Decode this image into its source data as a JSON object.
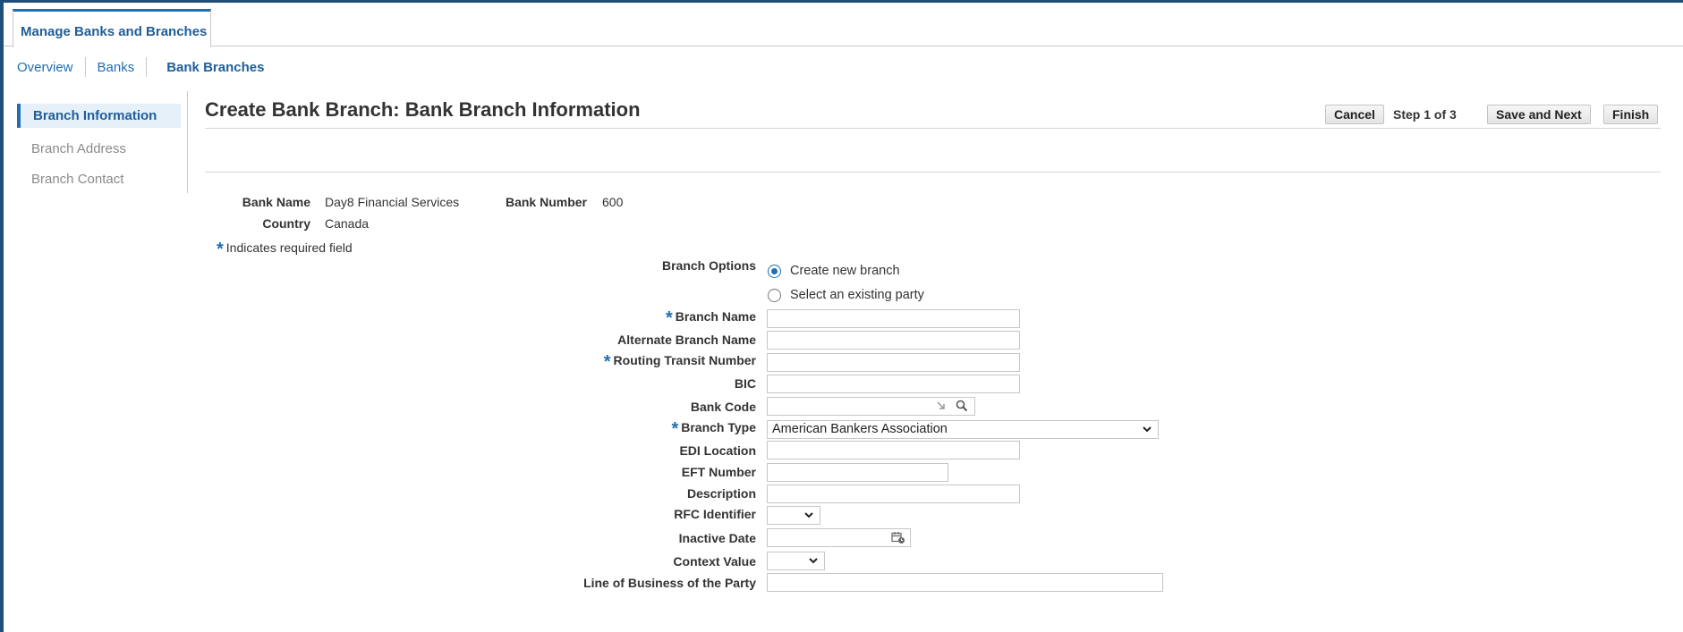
{
  "tab": {
    "label": "Manage Banks and Branches"
  },
  "subnav": {
    "overview": "Overview",
    "banks": "Banks",
    "bank_branches": "Bank Branches"
  },
  "train": {
    "items": [
      "Branch Information",
      "Branch Address",
      "Branch Contact"
    ]
  },
  "header": {
    "title": "Create Bank Branch: Bank Branch Information",
    "cancel": "Cancel",
    "step": "Step 1 of 3",
    "save_next": "Save and Next",
    "finish": "Finish"
  },
  "info": {
    "bank_name_label": "Bank Name",
    "bank_name": "Day8 Financial Services",
    "bank_number_label": "Bank Number",
    "bank_number": "600",
    "country_label": "Country",
    "country": "Canada",
    "required_note": "Indicates required field"
  },
  "form": {
    "branch_options_label": "Branch Options",
    "option_new": "Create new branch",
    "option_existing": "Select an existing party",
    "branch_name": "Branch Name",
    "alt_branch_name": "Alternate Branch Name",
    "routing_transit": "Routing Transit Number",
    "bic": "BIC",
    "bank_code": "Bank Code",
    "branch_type": "Branch Type",
    "branch_type_value": "American Bankers Association",
    "edi_location": "EDI Location",
    "eft_number": "EFT Number",
    "description": "Description",
    "rfc_identifier": "RFC Identifier",
    "inactive_date": "Inactive Date",
    "context_value": "Context Value",
    "line_of_business": "Line of Business of the Party"
  },
  "colors": {
    "accent": "#1f6fb2",
    "frame": "#1f4e7a"
  }
}
